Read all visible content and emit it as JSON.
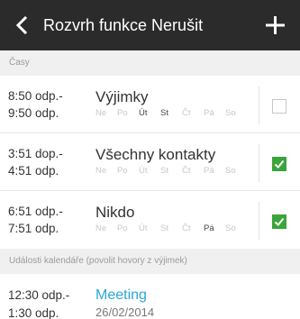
{
  "appbar": {
    "title": "Rozvrh funkce Nerušit",
    "back_icon": "chevron-left-icon",
    "add_icon": "plus-icon",
    "background": "#2b2b2b"
  },
  "sections": {
    "times_header": "Časy",
    "calendar_header": "Události kalendáře (povolit hovory z výjimek)"
  },
  "days_labels": [
    "Ne",
    "Po",
    "Út",
    "St",
    "Čt",
    "Pá",
    "So"
  ],
  "schedules": [
    {
      "start": "8:50 odp.-",
      "end": "9:50 odp.",
      "name": "Výjimky",
      "active_days": [
        "Út",
        "St"
      ],
      "checked": false
    },
    {
      "start": "3:51 dop.-",
      "end": "4:51 odp.",
      "name": "Všechny kontakty",
      "active_days": [],
      "checked": true
    },
    {
      "start": "6:51 odp.-",
      "end": "7:51 odp.",
      "name": "Nikdo",
      "active_days": [
        "Pá"
      ],
      "checked": true
    }
  ],
  "calendar_events": [
    {
      "start": "12:30 odp.-",
      "end": "1:30 odp.",
      "title": "Meeting",
      "date": "26/02/2014"
    }
  ],
  "colors": {
    "accent_green": "#3aa53a",
    "link_blue": "#2aa6d6"
  }
}
